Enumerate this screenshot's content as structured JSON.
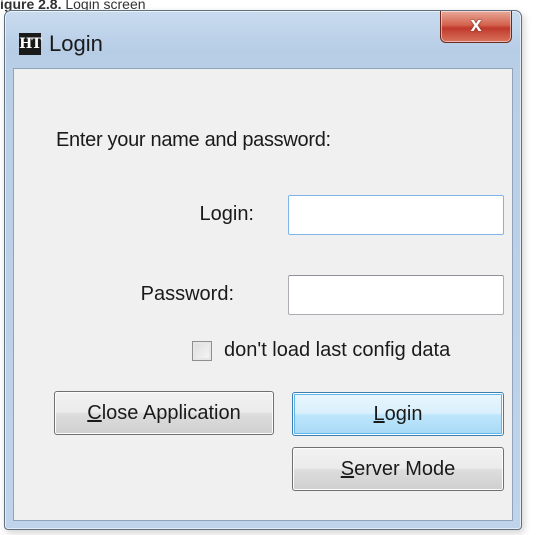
{
  "caption": {
    "figure_label": "igure 2.8.",
    "figure_text": " Login screen"
  },
  "window": {
    "app_icon_text": "HT",
    "title": "Login",
    "close_glyph": "x"
  },
  "form": {
    "prompt": "Enter your name and password:",
    "login_label": "Login:",
    "login_value": "",
    "password_label": "Password:",
    "password_value": "",
    "dont_load_checked": false,
    "dont_load_label": "don't load last config data"
  },
  "buttons": {
    "close_app": {
      "accel": "C",
      "rest": "lose Application"
    },
    "login": {
      "accel": "L",
      "rest": "ogin"
    },
    "server_mode": {
      "accel": "S",
      "rest": "erver Mode"
    }
  },
  "icons": {
    "app": "app-logo-icon",
    "close": "close-icon",
    "checkbox": "checkbox-icon"
  },
  "colors": {
    "frame": "#b9cfe6",
    "client": "#f0f0f0",
    "close_button": "#c0392b",
    "default_button_border": "#3c7fb1"
  }
}
